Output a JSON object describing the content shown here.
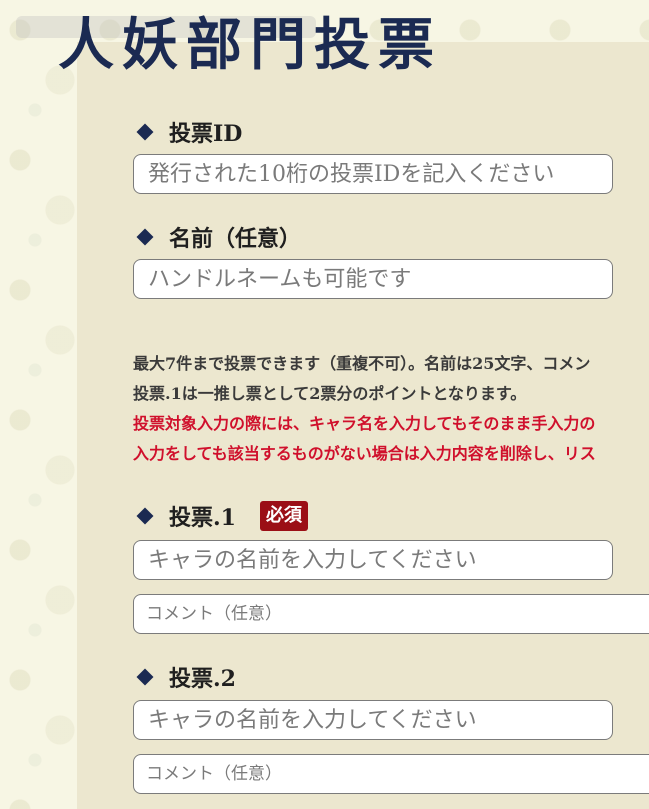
{
  "page": {
    "title": "人妖部門投票"
  },
  "form": {
    "vote_id": {
      "label": "投票ID",
      "placeholder": "発行された10桁の投票IDを記入ください"
    },
    "name": {
      "label": "名前（任意）",
      "placeholder": "ハンドルネームも可能です"
    },
    "notes": [
      "最大7件まで投票できます（重複不可）。名前は25文字、コメン",
      "投票.1は一推し票として2票分のポイントとなります。",
      "投票対象入力の際には、キャラ名を入力してもそのまま手入力の",
      "入力をしても該当するものがない場合は入力内容を削除し、リス"
    ],
    "votes": [
      {
        "label": "投票.1",
        "badge": "必須",
        "character_placeholder": "キャラの名前を入力してください",
        "comment_placeholder": "コメント（任意）"
      },
      {
        "label": "投票.2",
        "character_placeholder": "キャラの名前を入力してください",
        "comment_placeholder": "コメント（任意）"
      }
    ]
  },
  "colors": {
    "title": "#1b2a52",
    "badge": "#9b0f16",
    "warning_text": "#d0102c",
    "panel": "#ece7cf"
  }
}
